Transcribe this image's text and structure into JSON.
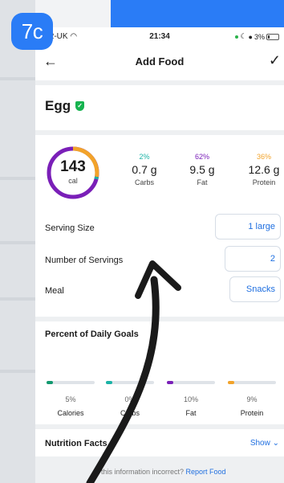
{
  "badge": "7c",
  "status": {
    "carrier": "O2-UK",
    "time": "21:34",
    "battery": "3%"
  },
  "nav": {
    "title": "Add Food"
  },
  "food": {
    "name": "Egg"
  },
  "summary": {
    "calories": "143",
    "cal_unit": "cal",
    "macros": [
      {
        "pct": "2%",
        "amount": "0.7 g",
        "label": "Carbs",
        "color": "#1bb3a6"
      },
      {
        "pct": "62%",
        "amount": "9.5 g",
        "label": "Fat",
        "color": "#7a1fb8"
      },
      {
        "pct": "36%",
        "amount": "12.6 g",
        "label": "Protein",
        "color": "#f2a32a"
      }
    ]
  },
  "serving": {
    "size_label": "Serving Size",
    "size_value": "1 large",
    "count_label": "Number of Servings",
    "count_value": "2",
    "meal_label": "Meal",
    "meal_value": "Snacks"
  },
  "goals": {
    "title": "Percent of Daily Goals",
    "items": [
      {
        "pct": "5%",
        "label": "Calories",
        "value": 0.05,
        "color": "#12996f"
      },
      {
        "pct": "0%",
        "label": "Carbs",
        "value": 0.0,
        "color": "#1bb3a6"
      },
      {
        "pct": "10%",
        "label": "Fat",
        "value": 0.1,
        "color": "#7a1fb8"
      },
      {
        "pct": "9%",
        "label": "Protein",
        "value": 0.09,
        "color": "#f2a32a"
      }
    ]
  },
  "nutrition": {
    "label": "Nutrition Facts",
    "show": "Show"
  },
  "footer": {
    "question": "Is this information incorrect?",
    "link": "Report Food"
  },
  "colors": {
    "accent": "#1f6fe0",
    "badge": "#2a7cf6",
    "verified": "#16b34f"
  }
}
